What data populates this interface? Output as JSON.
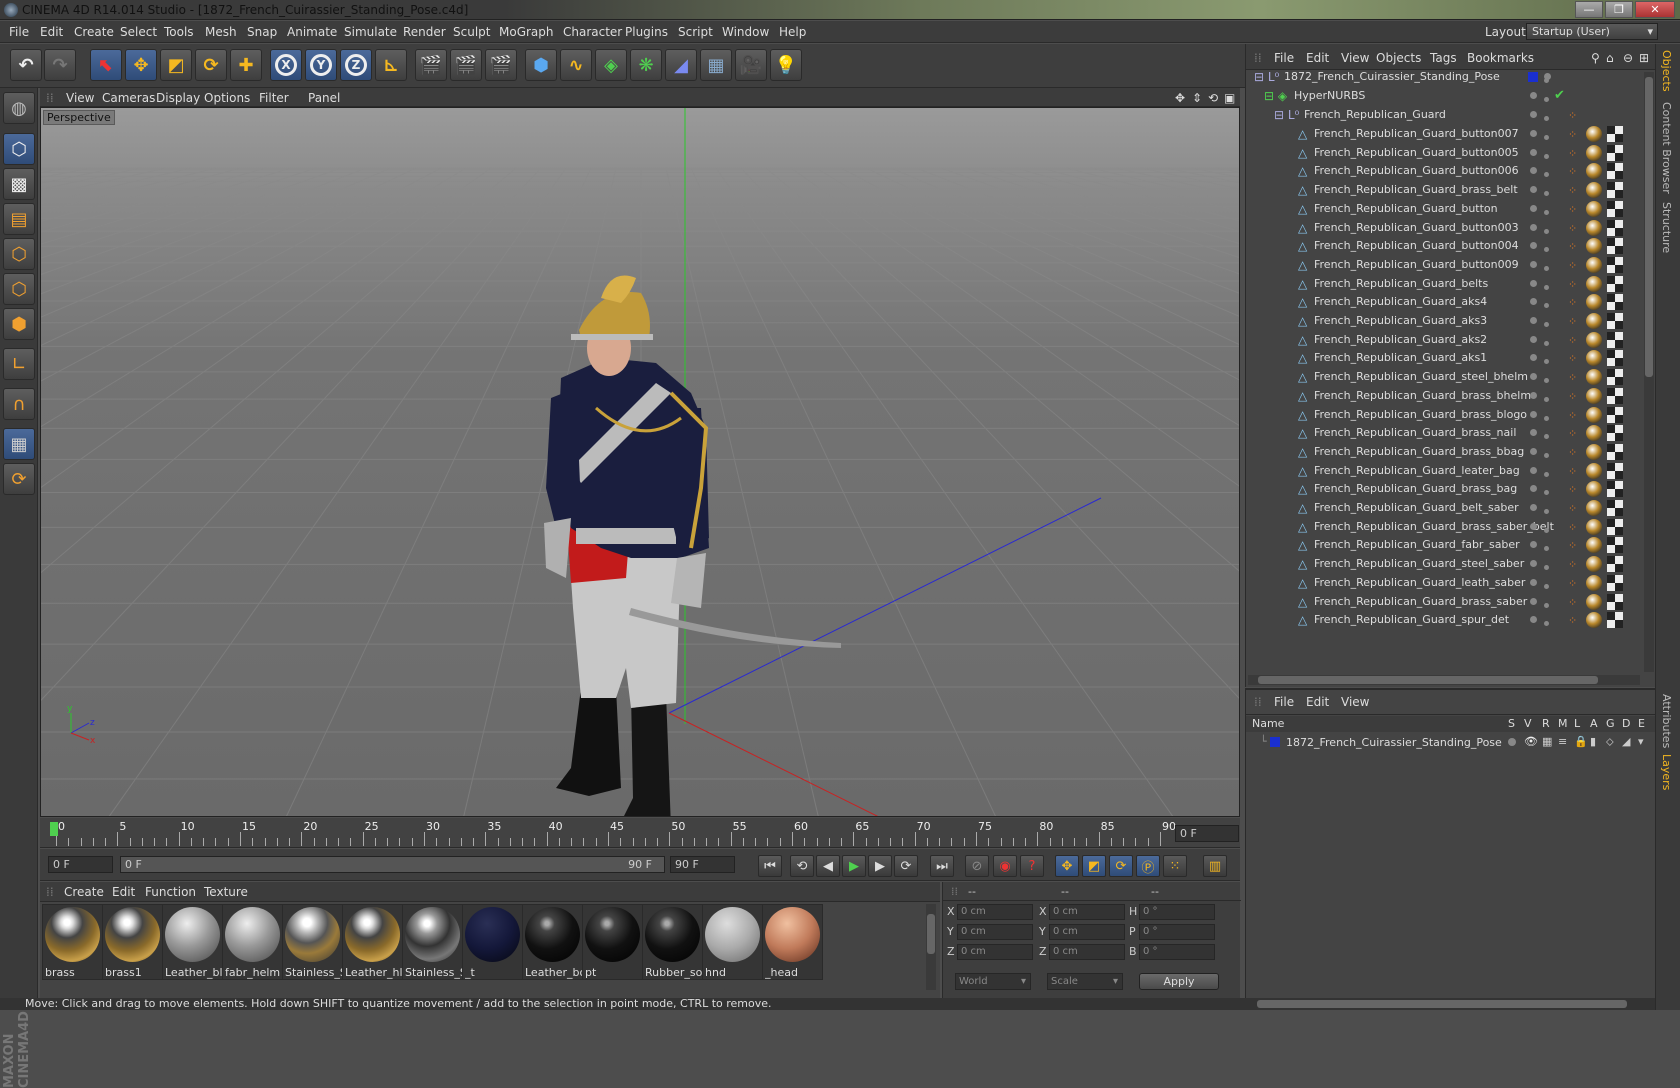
{
  "window": {
    "title": "CINEMA 4D R14.014 Studio - [1872_French_Cuirassier_Standing_Pose.c4d]",
    "buttons": [
      "—",
      "❐",
      "✕"
    ]
  },
  "menubar": {
    "items": [
      "File",
      "Edit",
      "Create",
      "Select",
      "Tools",
      "Mesh",
      "Snap",
      "Animate",
      "Simulate",
      "Render",
      "Sculpt",
      "MoGraph",
      "Character",
      "Plugins",
      "Script",
      "Window",
      "Help"
    ],
    "layout_label": "Layout:",
    "layout_value": "Startup (User)"
  },
  "viewport": {
    "menu": [
      "View",
      "Cameras",
      "Display",
      "Options",
      "Filter",
      "Panel"
    ],
    "label": "Perspective"
  },
  "timeline": {
    "ticks": [
      "0",
      "5",
      "10",
      "15",
      "20",
      "25",
      "30",
      "35",
      "40",
      "45",
      "50",
      "55",
      "60",
      "65",
      "70",
      "75",
      "80",
      "85",
      "90"
    ],
    "frame_out": "0 F"
  },
  "transport": {
    "start": "0 F",
    "range_start": "0 F",
    "range_end": "90 F",
    "end": "90 F"
  },
  "materials": {
    "menu": [
      "Create",
      "Edit",
      "Function",
      "Texture"
    ],
    "items": [
      {
        "name": "brass",
        "type": "brass"
      },
      {
        "name": "brass1",
        "type": "brass"
      },
      {
        "name": "Leather_bl",
        "type": "grey"
      },
      {
        "name": "fabr_helm",
        "type": "grey"
      },
      {
        "name": "Stainless_S",
        "type": "chrome"
      },
      {
        "name": "Leather_hl",
        "type": "brass"
      },
      {
        "name": "Stainless_S",
        "type": "chromedark"
      },
      {
        "name": "_t",
        "type": "navy"
      },
      {
        "name": "Leather_bo",
        "type": "black"
      },
      {
        "name": "pt",
        "type": "black"
      },
      {
        "name": "Rubber_so",
        "type": "black"
      },
      {
        "name": "hnd",
        "type": "lightgrey"
      },
      {
        "name": "_head",
        "type": "skin"
      }
    ]
  },
  "coords": {
    "headers": [
      "--",
      "--",
      "--"
    ],
    "rows": [
      {
        "l1": "X",
        "v1": "0 cm",
        "l2": "X",
        "v2": "0 cm",
        "l3": "H",
        "v3": "0 °"
      },
      {
        "l1": "Y",
        "v1": "0 cm",
        "l2": "Y",
        "v2": "0 cm",
        "l3": "P",
        "v3": "0 °"
      },
      {
        "l1": "Z",
        "v1": "0 cm",
        "l2": "Z",
        "v2": "0 cm",
        "l3": "B",
        "v3": "0 °"
      }
    ],
    "world": "World",
    "scale": "Scale",
    "apply": "Apply"
  },
  "objects": {
    "menu": [
      "File",
      "Edit",
      "View",
      "Objects",
      "Tags",
      "Bookmarks"
    ],
    "root": "1872_French_Cuirassier_Standing_Pose",
    "hypernurbs": "HyperNURBS",
    "group": "French_Republican_Guard",
    "children": [
      "French_Republican_Guard_button007",
      "French_Republican_Guard_button005",
      "French_Republican_Guard_button006",
      "French_Republican_Guard_brass_belt",
      "French_Republican_Guard_button",
      "French_Republican_Guard_button003",
      "French_Republican_Guard_button004",
      "French_Republican_Guard_button009",
      "French_Republican_Guard_belts",
      "French_Republican_Guard_aks4",
      "French_Republican_Guard_aks3",
      "French_Republican_Guard_aks2",
      "French_Republican_Guard_aks1",
      "French_Republican_Guard_steel_bhelm",
      "French_Republican_Guard_brass_bhelm",
      "French_Republican_Guard_brass_blogo",
      "French_Republican_Guard_brass_nail",
      "French_Republican_Guard_brass_bbag",
      "French_Republican_Guard_leater_bag",
      "French_Republican_Guard_brass_bag",
      "French_Republican_Guard_belt_saber",
      "French_Republican_Guard_brass_saber_belt",
      "French_Republican_Guard_fabr_saber",
      "French_Republican_Guard_steel_saber",
      "French_Republican_Guard_leath_saber",
      "French_Republican_Guard_brass_saber",
      "French_Republican_Guard_spur_det"
    ]
  },
  "layers": {
    "menu": [
      "File",
      "Edit",
      "View"
    ],
    "columns": [
      "Name",
      "S",
      "V",
      "R",
      "M",
      "L",
      "A",
      "G",
      "D",
      "E"
    ],
    "row": "1872_French_Cuirassier_Standing_Pose",
    "layer_color": "#1a2fd0"
  },
  "right_tabs": [
    "Objects",
    "Content Browser",
    "Structure",
    "Attributes",
    "Layers"
  ],
  "status": "Move: Click and drag to move elements. Hold down SHIFT to quantize movement / add to the selection in point mode, CTRL to remove."
}
